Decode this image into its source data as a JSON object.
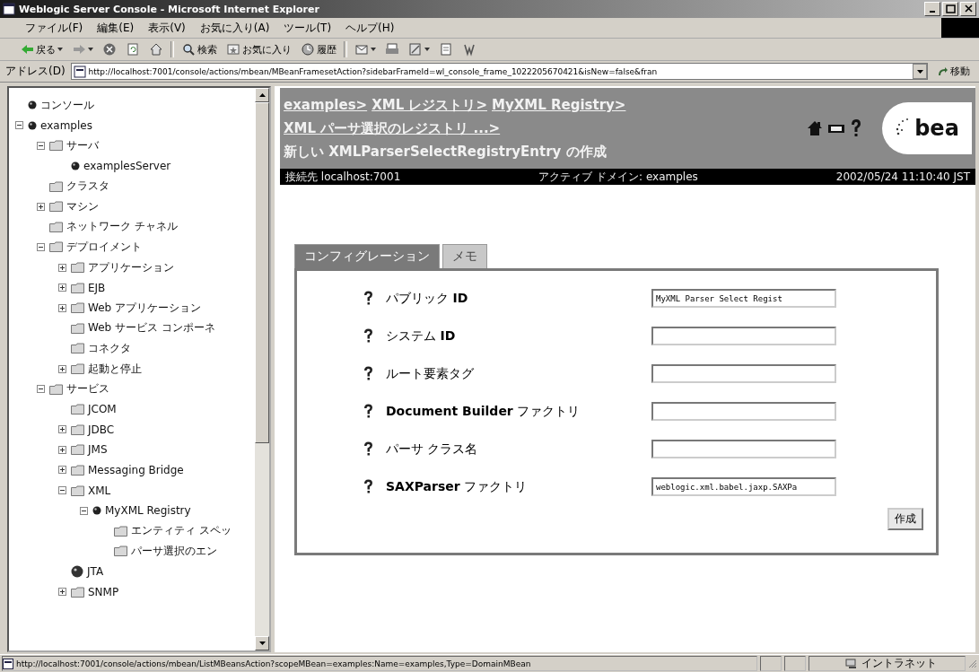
{
  "window": {
    "title": "Weblogic Server Console - Microsoft Internet Explorer"
  },
  "menu": [
    "ファイル(F)",
    "編集(E)",
    "表示(V)",
    "お気に入り(A)",
    "ツール(T)",
    "ヘルプ(H)"
  ],
  "toolbar": [
    {
      "kind": "back",
      "label": "戻る"
    },
    {
      "kind": "forward"
    },
    {
      "kind": "stop"
    },
    {
      "kind": "refresh"
    },
    {
      "kind": "home"
    },
    {
      "kind": "search",
      "label": "検索"
    },
    {
      "kind": "favorites",
      "label": "お気に入り"
    },
    {
      "kind": "history",
      "label": "履歴"
    },
    {
      "kind": "mail"
    },
    {
      "kind": "print"
    },
    {
      "kind": "edit"
    },
    {
      "kind": "discuss"
    },
    {
      "kind": "messenger"
    }
  ],
  "address_bar": {
    "label": "アドレス(D)",
    "value": "http://localhost:7001/console/actions/mbean/MBeanFramesetAction?sidebarFrameId=wl_console_frame_1022205670421&isNew=false&fran",
    "go": "移動"
  },
  "sidebar": {
    "items": [
      {
        "label": "コンソール",
        "kind": "ball"
      },
      {
        "label": "examples",
        "kind": "ball",
        "expanded": true,
        "children": [
          {
            "label": "サーバ",
            "kind": "folder",
            "expanded": true,
            "children": [
              {
                "label": "examplesServer",
                "kind": "ball"
              }
            ]
          },
          {
            "label": "クラスタ",
            "kind": "folder"
          },
          {
            "label": "マシン",
            "kind": "folder",
            "expanded": false
          },
          {
            "label": "ネットワーク チャネル",
            "kind": "folder"
          },
          {
            "label": "デプロイメント",
            "kind": "folder",
            "expanded": true,
            "children": [
              {
                "label": "アプリケーション",
                "kind": "folder",
                "expanded": false
              },
              {
                "label": "EJB",
                "kind": "folder",
                "expanded": false
              },
              {
                "label": "Web アプリケーション",
                "kind": "folder",
                "expanded": false
              },
              {
                "label": "Web サービス コンポーネ",
                "kind": "folder"
              },
              {
                "label": "コネクタ",
                "kind": "folder"
              },
              {
                "label": "起動と停止",
                "kind": "folder",
                "expanded": false
              }
            ]
          },
          {
            "label": "サービス",
            "kind": "folder",
            "expanded": true,
            "children": [
              {
                "label": "JCOM",
                "kind": "folder"
              },
              {
                "label": "JDBC",
                "kind": "folder",
                "expanded": false
              },
              {
                "label": "JMS",
                "kind": "folder",
                "expanded": false
              },
              {
                "label": "Messaging Bridge",
                "kind": "folder",
                "expanded": false
              },
              {
                "label": "XML",
                "kind": "folder",
                "expanded": true,
                "children": [
                  {
                    "label": "MyXML Registry",
                    "kind": "ball",
                    "expanded": true,
                    "children": [
                      {
                        "label": "エンティティ スペッ",
                        "kind": "folder"
                      },
                      {
                        "label": "パーサ選択のエン",
                        "kind": "folder"
                      }
                    ]
                  }
                ]
              },
              {
                "label": "JTA",
                "kind": "globe"
              },
              {
                "label": "SNMP",
                "kind": "folder",
                "expanded": false
              }
            ]
          }
        ]
      }
    ]
  },
  "header": {
    "breadcrumb": [
      {
        "label": "examples>",
        "link": true
      },
      {
        "label": "XML レジストリ>",
        "link": true
      },
      {
        "label": "MyXML Registry>",
        "link": true
      },
      {
        "label": "XML パーサ選択のレジストリ ...>",
        "link": true
      },
      {
        "label": "新しい XMLParserSelectRegistryEntry の作成",
        "link": false
      }
    ],
    "logo": "bea",
    "info": [
      "接続先 localhost:7001",
      "アクティブ ドメイン: examples",
      "2002/05/24 11:10:40 JST"
    ]
  },
  "tabs": [
    {
      "label": "コンフィグレーション",
      "selected": true
    },
    {
      "label": "メモ",
      "selected": false
    }
  ],
  "form": {
    "fields": [
      {
        "label": "パブリック **ID**",
        "value": "MyXML Parser Select Regist"
      },
      {
        "label": "システム **ID**"
      },
      {
        "label": "ルート要素タグ"
      },
      {
        "label": "**Document Builder** ファクトリ"
      },
      {
        "label": "パーサ クラス名"
      },
      {
        "label": "**SAXParser** ファクトリ",
        "value": "weblogic.xml.babel.jaxp.SAXPa"
      }
    ],
    "button": "作成"
  },
  "status_bar": {
    "text": "http://localhost:7001/console/actions/mbean/ListMBeansAction?scopeMBean=examples:Name=examples,Type=DomainMBean",
    "zone": "イントラネット"
  }
}
